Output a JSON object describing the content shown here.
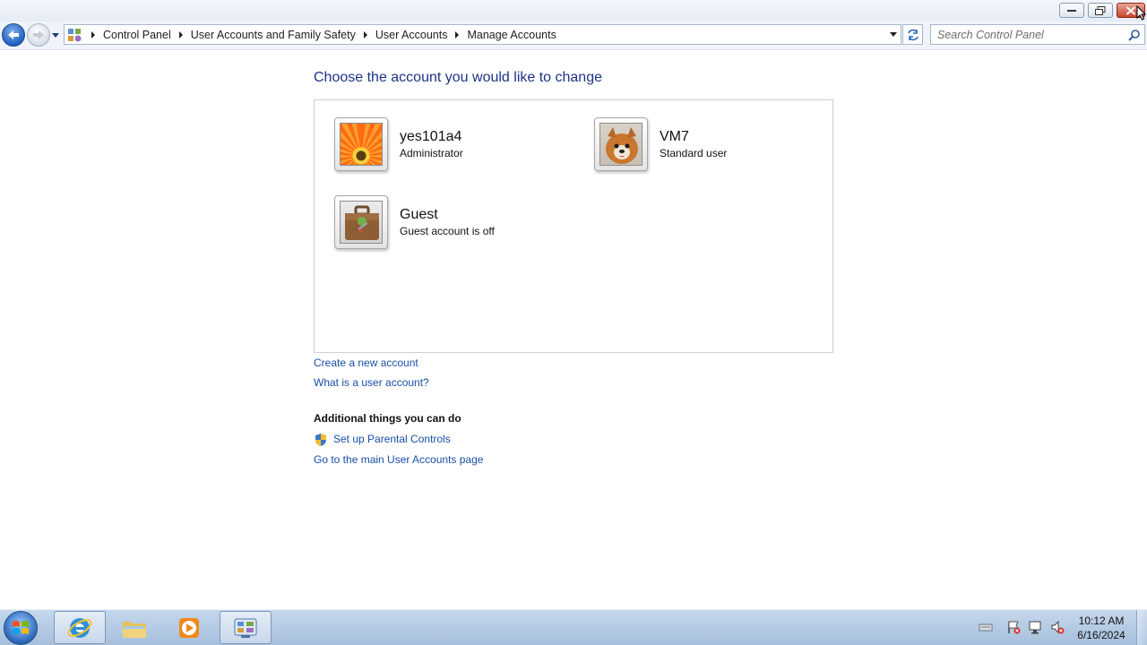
{
  "window": {
    "minimize_icon": "minimize-icon",
    "maximize_icon": "restore-icon",
    "close_icon": "close-icon"
  },
  "nav": {
    "back_icon": "back-arrow-icon",
    "forward_icon": "forward-arrow-icon",
    "breadcrumbs": [
      "Control Panel",
      "User Accounts and Family Safety",
      "User Accounts",
      "Manage Accounts"
    ],
    "search_placeholder": "Search Control Panel"
  },
  "main": {
    "heading": "Choose the account you would like to change",
    "accounts": [
      {
        "name": "yes101a4",
        "type": "Administrator",
        "picture": "orange-flower"
      },
      {
        "name": "VM7",
        "type": "Standard user",
        "picture": "puppy"
      },
      {
        "name": "Guest",
        "type": "Guest account is off",
        "picture": "briefcase"
      }
    ],
    "links": {
      "create": "Create a new account",
      "what_is": "What is a user account?"
    },
    "additional": {
      "heading": "Additional things you can do",
      "parental": "Set up Parental Controls",
      "main_page": "Go to the main User Accounts page"
    }
  },
  "taskbar": {
    "time": "10:12 AM",
    "date": "6/16/2024",
    "apps": [
      "internet-explorer",
      "windows-explorer",
      "media-player",
      "control-panel"
    ]
  },
  "colors": {
    "heading": "#1e3287",
    "link": "#1a4fa6",
    "close": "#c8452c"
  }
}
